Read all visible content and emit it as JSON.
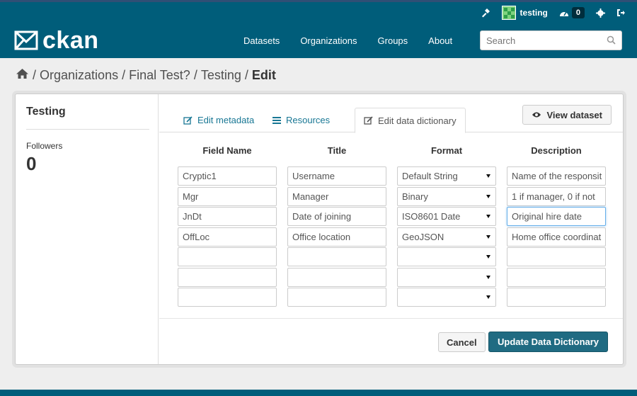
{
  "account": {
    "username": "testing",
    "dashboard_count": "0",
    "icons": [
      "hammer-icon",
      "dashboard-icon",
      "gear-icon",
      "sign-out-icon"
    ]
  },
  "site": {
    "logo_text": "ckan",
    "nav": [
      {
        "label": "Datasets"
      },
      {
        "label": "Organizations"
      },
      {
        "label": "Groups"
      },
      {
        "label": "About"
      }
    ],
    "search_placeholder": "Search"
  },
  "breadcrumb": {
    "sep": "/",
    "items": [
      "Organizations",
      "Final Test?",
      "Testing"
    ],
    "active": "Edit"
  },
  "sidebar": {
    "title": "Testing",
    "followers_label": "Followers",
    "followers_count": "0"
  },
  "tabs": [
    {
      "label": "Edit metadata",
      "icon": "edit-icon"
    },
    {
      "label": "Resources",
      "icon": "list-icon"
    },
    {
      "label": "Edit data dictionary",
      "icon": "edit-icon",
      "active": true
    }
  ],
  "view_dataset_label": "View dataset",
  "dictionary": {
    "headers": [
      "Field Name",
      "Title",
      "Format",
      "Description"
    ],
    "rows": [
      {
        "field": "Cryptic1",
        "title": "Username",
        "format": "Default String",
        "description": "Name of the responsit"
      },
      {
        "field": "Mgr",
        "title": "Manager",
        "format": "Binary",
        "description": "1 if manager, 0 if not"
      },
      {
        "field": "JnDt",
        "title": "Date of joining",
        "format": "ISO8601 Date",
        "description": "Original hire date"
      },
      {
        "field": "OffLoc",
        "title": "Office location",
        "format": "GeoJSON",
        "description": "Home office coordinat"
      },
      {
        "field": "",
        "title": "",
        "format": "",
        "description": ""
      },
      {
        "field": "",
        "title": "",
        "format": "",
        "description": ""
      },
      {
        "field": "",
        "title": "",
        "format": "",
        "description": ""
      }
    ]
  },
  "buttons": {
    "cancel": "Cancel",
    "update": "Update Data Dictionary"
  },
  "colors": {
    "masthead": "#005d7a",
    "primary_button": "#206b82",
    "link": "#187794"
  }
}
